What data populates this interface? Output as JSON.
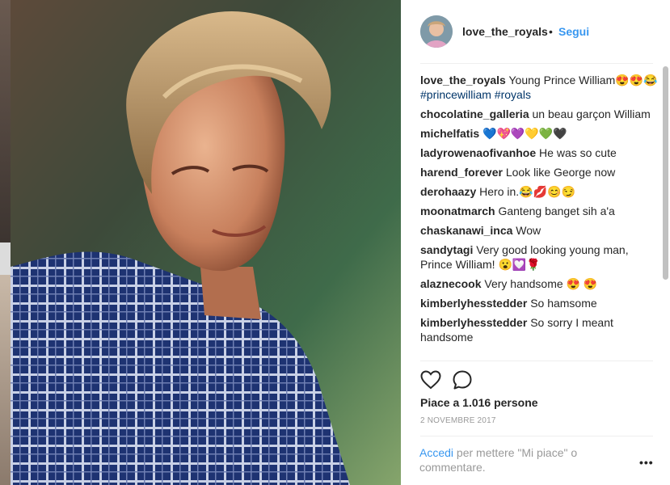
{
  "header": {
    "username": "love_the_royals",
    "separator": "•",
    "follow_label": "Segui"
  },
  "comments": [
    {
      "user": "love_the_royals",
      "text": "Young Prince William😍😍😂 ",
      "tags": "#princewilliam #royals"
    },
    {
      "user": "chocolatine_galleria",
      "text": "un beau garçon William"
    },
    {
      "user": "michelfatis",
      "text": "💙💖💜💛💚🖤"
    },
    {
      "user": "ladyrowenaofivanhoe",
      "text": "He was so cute"
    },
    {
      "user": "harend_forever",
      "text": "Look like George now"
    },
    {
      "user": "derohaazy",
      "text": "Hero in.😂💋😊😏"
    },
    {
      "user": "moonatmarch",
      "text": "Ganteng banget sih a'a"
    },
    {
      "user": "chaskanawi_inca",
      "text": "Wow"
    },
    {
      "user": "sandytagi",
      "text": "Very good looking young man, Prince William! 😮💟🌹"
    },
    {
      "user": "alaznecook",
      "text": "Very handsome 😍 😍"
    },
    {
      "user": "kimberlyhesstedder",
      "text": "So hamsome"
    },
    {
      "user": "kimberlyhesstedder",
      "text": "So sorry I meant handsome"
    }
  ],
  "actions": {
    "like_icon": "heart-outline-icon",
    "comment_icon": "comment-bubble-icon",
    "likes_text": "Piace a 1.016 persone",
    "date": "2 NOVEMBRE 2017"
  },
  "footer": {
    "login_link": "Accedi",
    "login_text": " per mettere \"Mi piace\" o commentare.",
    "more_label": "•••"
  },
  "colors": {
    "link_blue": "#3897f0",
    "hashtag_blue": "#003569",
    "muted": "#999999"
  }
}
